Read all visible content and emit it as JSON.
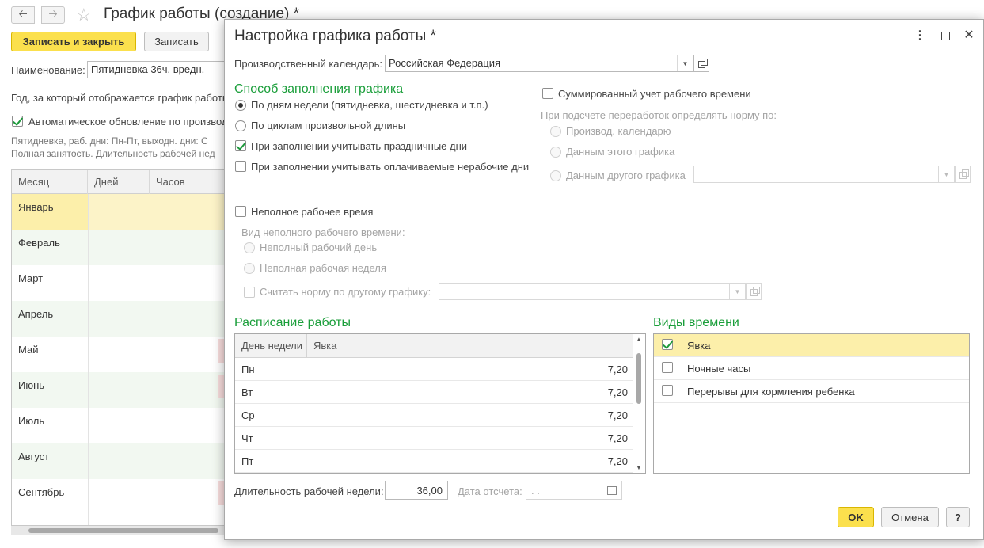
{
  "background": {
    "title": "График работы (создание) *",
    "save_close_label": "Записать и закрыть",
    "save_label": "Записать",
    "name_label": "Наименование:",
    "name_value": "Пятидневка 36ч. вредн.",
    "year_label": "Год, за который отображается график работы",
    "auto_update_label": "Автоматическое обновление по производ",
    "desc_line1": "Пятидневка, раб. дни: Пн-Пт, выходн. дни: С",
    "desc_line2": "Полная занятость. Длительность рабочей нед",
    "table": {
      "headers": [
        "Месяц",
        "Дней",
        "Часов"
      ],
      "months": [
        "Январь",
        "Февраль",
        "Март",
        "Апрель",
        "Май",
        "Июнь",
        "Июль",
        "Август",
        "Сентябрь"
      ]
    }
  },
  "dialog": {
    "title": "Настройка графика работы *",
    "more_icon": "⋮",
    "close_icon": "✕",
    "calendar_label": "Производственный календарь:",
    "calendar_value": "Российская Федерация",
    "fill_section_title": "Способ заполнения графика",
    "fill_options": [
      "По дням недели (пятидневка, шестидневка и т.п.)",
      "По циклам произвольной длины"
    ],
    "holidays_label": "При заполнении учитывать праздничные дни",
    "paid_nonwork_label": "При заполнении учитывать оплачиваемые нерабочие дни",
    "summarized_label": "Суммированный учет рабочего времени",
    "overtime_label": "При подсчете переработок определять норму по:",
    "overtime_options": [
      "Производ. календарю",
      "Данным этого графика",
      "Данным другого графика"
    ],
    "parttime_label": "Неполное рабочее время",
    "parttime_kind_label": "Вид неполного рабочего времени:",
    "parttime_options": [
      "Неполный рабочий день",
      "Неполная рабочая неделя"
    ],
    "norm_other_label": "Считать норму по другому графику:",
    "schedule_title": "Расписание работы",
    "schedule_headers": [
      "День недели",
      "Явка"
    ],
    "schedule_rows": [
      {
        "day": "Пн",
        "value": "7,20"
      },
      {
        "day": "Вт",
        "value": "7,20"
      },
      {
        "day": "Ср",
        "value": "7,20"
      },
      {
        "day": "Чт",
        "value": "7,20"
      },
      {
        "day": "Пт",
        "value": "7,20"
      }
    ],
    "time_types_title": "Виды времени",
    "time_types": [
      {
        "label": "Явка",
        "checked": true
      },
      {
        "label": "Ночные часы",
        "checked": false
      },
      {
        "label": "Перерывы для кормления ребенка",
        "checked": false
      }
    ],
    "week_length_label": "Длительность рабочей недели:",
    "week_length_value": "36,00",
    "ref_date_label": "Дата отсчета:",
    "ref_date_value": " .  .",
    "ok_label": "OK",
    "cancel_label": "Отмена",
    "help_label": "?"
  },
  "colors": {
    "accent_green": "#1a9e3a",
    "button_yellow": "#fbe04d",
    "selected_row": "#fcefaa"
  }
}
